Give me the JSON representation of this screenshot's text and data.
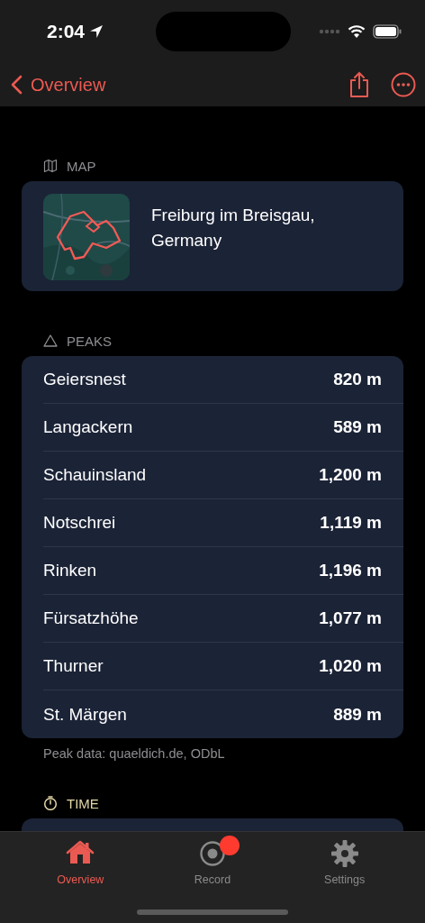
{
  "status_bar": {
    "time": "2:04"
  },
  "nav": {
    "back_label": "Overview"
  },
  "sections": [
    {
      "kind": "map",
      "header": "MAP",
      "place": "Freiburg im Breisgau, Germany"
    },
    {
      "kind": "peaks",
      "header": "PEAKS",
      "rows": [
        {
          "name": "Geiersnest",
          "elevation": "820 m"
        },
        {
          "name": "Langackern",
          "elevation": "589 m"
        },
        {
          "name": "Schauinsland",
          "elevation": "1,200 m"
        },
        {
          "name": "Notschrei",
          "elevation": "1,119 m"
        },
        {
          "name": "Rinken",
          "elevation": "1,196 m"
        },
        {
          "name": "Fürsatzhöhe",
          "elevation": "1,077 m"
        },
        {
          "name": "Thurner",
          "elevation": "1,020 m"
        },
        {
          "name": "St. Märgen",
          "elevation": "889 m"
        }
      ],
      "footnote": "Peak data: quaeldich.de, ODbL"
    },
    {
      "kind": "time",
      "header": "TIME"
    }
  ],
  "tabs": [
    {
      "kind": "home",
      "label": "Overview",
      "selected": true,
      "badge": false
    },
    {
      "kind": "record",
      "label": "Record",
      "selected": false,
      "badge": true
    },
    {
      "kind": "settings",
      "label": "Settings",
      "selected": false,
      "badge": false
    }
  ]
}
